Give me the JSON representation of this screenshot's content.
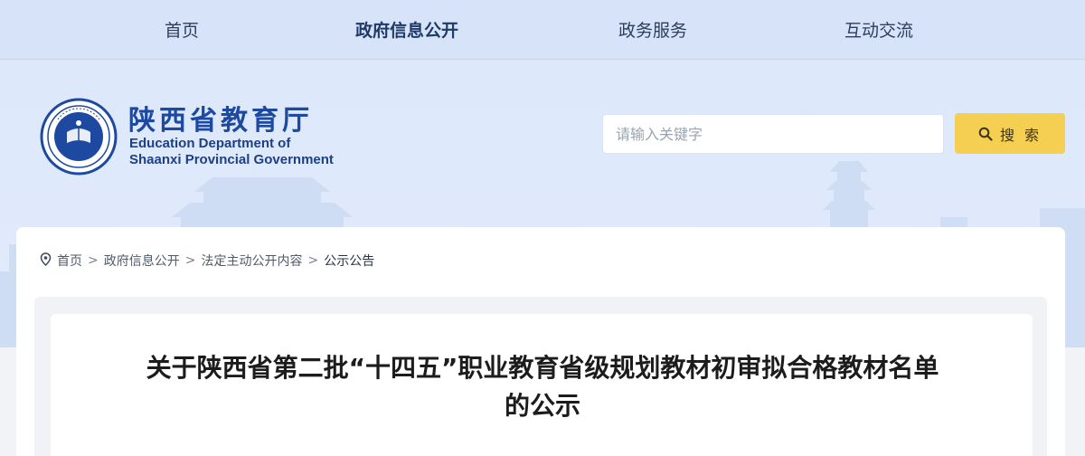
{
  "nav": {
    "items": [
      {
        "label": "首页",
        "active": false
      },
      {
        "label": "政府信息公开",
        "active": true
      },
      {
        "label": "政务服务",
        "active": false
      },
      {
        "label": "互动交流",
        "active": false
      }
    ]
  },
  "brand": {
    "name_cn": "陕西省教育厅",
    "name_en_line1": "Education Department of",
    "name_en_line2": "Shaanxi Provincial Government",
    "logo_text": "EDS"
  },
  "search": {
    "placeholder": "请输入关键字",
    "button_label": "搜 索"
  },
  "breadcrumb": {
    "items": [
      "首页",
      "政府信息公开",
      "法定主动公开内容",
      "公示公告"
    ],
    "separator": ">"
  },
  "article": {
    "title_line1": "关于陕西省第二批“十四五”职业教育省级规划教材初审拟合格教材名单",
    "title_line2": "的公示"
  },
  "colors": {
    "nav_bg": "#d6e3f9",
    "brand_blue": "#1d4aa0",
    "search_button": "#f5cf52",
    "hero_bg": "#dce8fb"
  }
}
